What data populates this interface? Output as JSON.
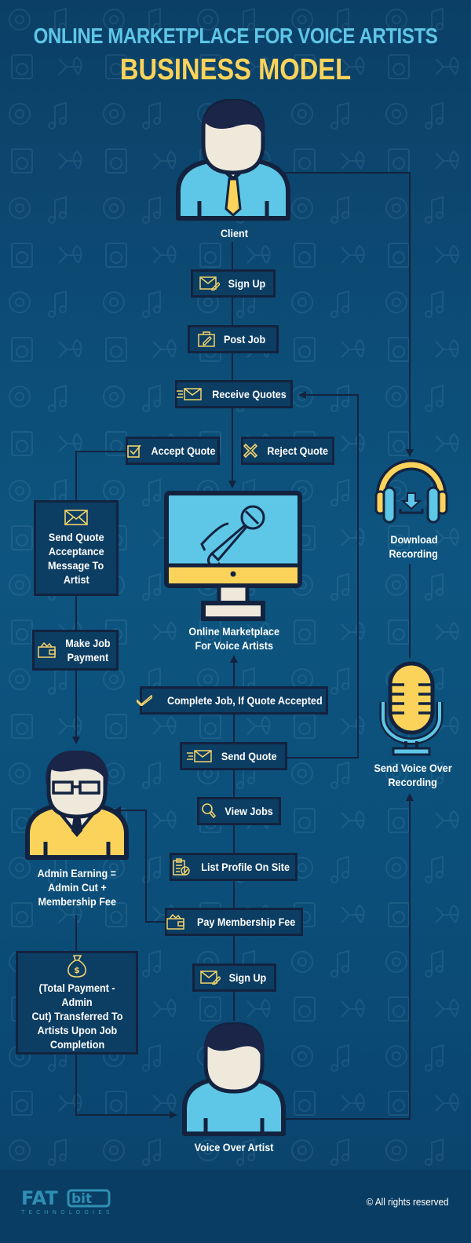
{
  "header": {
    "title": "ONLINE MARKETPLACE FOR VOICE ARTISTS",
    "subtitle": "BUSINESS MODEL"
  },
  "colors": {
    "background": "#0b4a74",
    "title_blue": "#5ec6e6",
    "title_yellow": "#fbd35a",
    "box_fill": "#0c3d63",
    "box_border": "#13233f",
    "icon_yellow": "#f3d36b"
  },
  "actors": {
    "client": "Client",
    "marketplace": "Online Marketplace For Voice Artists",
    "marketplace_line1": "Online Marketplace",
    "marketplace_line2": "For Voice Artists",
    "admin_line1": "Admin Earning =",
    "admin_line2": "Admin Cut +",
    "admin_line3": "Membership Fee",
    "artist": "Voice Over Artist",
    "download_line1": "Download",
    "download_line2": "Recording",
    "send_recording_line1": "Send Voice Over",
    "send_recording_line2": "Recording"
  },
  "client_flow": [
    {
      "label": "Sign Up",
      "icon": "envelope-pen-icon"
    },
    {
      "label": "Post Job",
      "icon": "briefcase-pen-icon"
    },
    {
      "label": "Receive Quotes",
      "icon": "fast-mail-icon"
    },
    {
      "label": "Accept Quote",
      "icon": "checkbox-icon"
    },
    {
      "label": "Reject Quote",
      "icon": "cross-icon"
    }
  ],
  "admin_flow": [
    {
      "label": "Send Quote Acceptance Message To Artist",
      "lines": [
        "Send Quote",
        "Acceptance",
        "Message To",
        "Artist"
      ],
      "icon": "envelope-icon"
    },
    {
      "label": "Make Job Payment",
      "lines": [
        "Make Job",
        "Payment"
      ],
      "icon": "wallet-icon"
    },
    {
      "label": "(Total Payment - Admin Cut) Transferred To Artists  Upon Job Completion",
      "lines": [
        "(Total Payment - Admin",
        "Cut) Transferred To",
        "Artists  Upon Job",
        "Completion"
      ],
      "icon": "money-bag-icon"
    }
  ],
  "artist_flow": [
    {
      "label": "Complete Job, If Quote Accepted",
      "icon": "check-icon"
    },
    {
      "label": "Send Quote",
      "icon": "fast-mail-icon"
    },
    {
      "label": "View Jobs",
      "icon": "search-icon"
    },
    {
      "label": "List Profile On Site",
      "icon": "clipboard-icon"
    },
    {
      "label": "Pay Membership Fee",
      "icon": "wallet-icon"
    },
    {
      "label": "Sign Up",
      "icon": "envelope-pen-icon"
    }
  ],
  "footer": {
    "logo_main": "FAT",
    "logo_accent": "bit",
    "logo_sub": "TECHNOLOGIES",
    "copyright": "© All rights reserved"
  }
}
